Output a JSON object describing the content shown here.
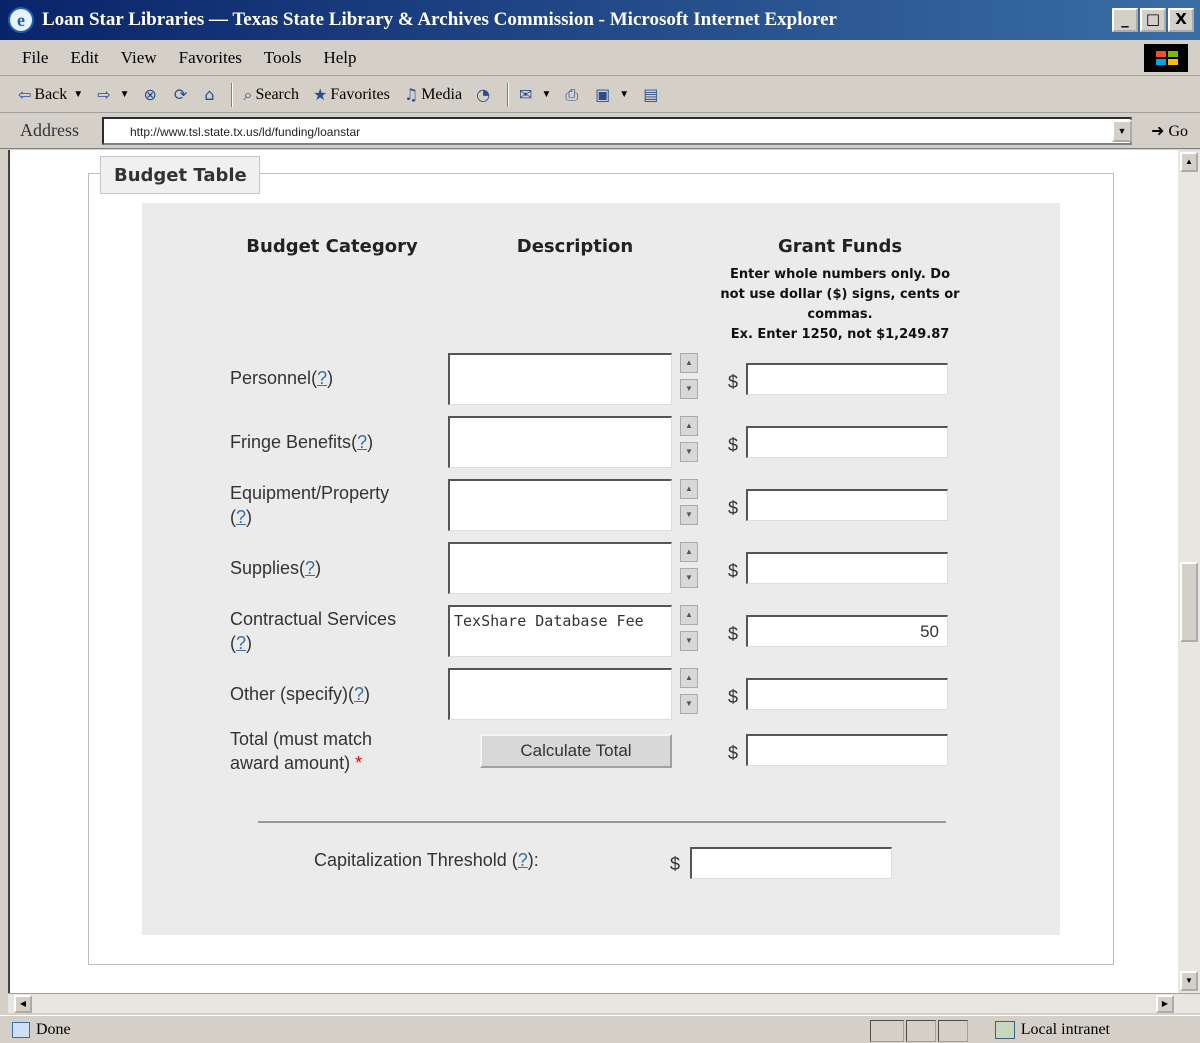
{
  "window": {
    "title": "Loan Star Libraries — Texas State Library & Archives Commission - Microsoft Internet Explorer",
    "minimize": "_",
    "maximize": "□",
    "close": "X"
  },
  "menu": [
    "File",
    "Edit",
    "View",
    "Favorites",
    "Tools",
    "Help"
  ],
  "toolbar": {
    "back": "Back",
    "search": "Search",
    "favorites": "Favorites",
    "media": "Media"
  },
  "address": {
    "label": "Address",
    "url": "http://www.tsl.state.tx.us/ld/funding/loanstar",
    "go": "Go"
  },
  "status": {
    "left": "Done",
    "zone": "Local intranet"
  },
  "form": {
    "legend": "Budget Table",
    "headers": {
      "category": "Budget Category",
      "description": "Description",
      "funds": "Grant Funds",
      "funds_note_1": "Enter whole numbers only. Do",
      "funds_note_2": "not use dollar ($) signs, cents or",
      "funds_note_3": "commas.",
      "funds_note_4": "Ex. Enter 1250, not $1,249.87"
    },
    "help_link": "?",
    "currency": "$",
    "rows": [
      {
        "label": "Personnel",
        "description": "",
        "amount": ""
      },
      {
        "label": "Fringe Benefits",
        "description": "",
        "amount": ""
      },
      {
        "label": "Equipment/Property",
        "description": "",
        "amount": ""
      },
      {
        "label": "Supplies",
        "description": "",
        "amount": ""
      },
      {
        "label": "Contractual Services",
        "description": "TexShare Database Fee",
        "amount": "50"
      },
      {
        "label": "Other (specify)",
        "description": "",
        "amount": ""
      }
    ],
    "total": {
      "label_line1": "Total (must match",
      "label_line2": "award amount)",
      "required_mark": "*",
      "amount": ""
    },
    "calculate_button": "Calculate Total",
    "capitalization": {
      "label": "Capitalization Threshold",
      "suffix": ":",
      "value": ""
    }
  }
}
